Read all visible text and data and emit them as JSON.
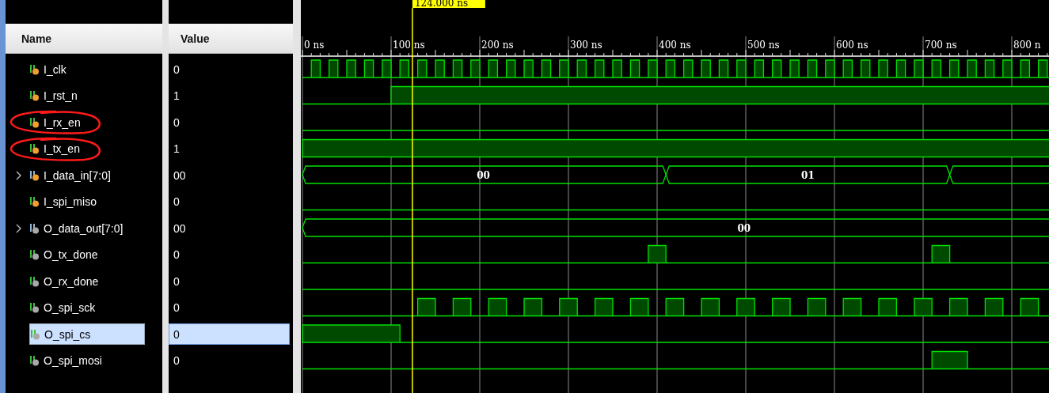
{
  "headers": {
    "name": "Name",
    "value": "Value"
  },
  "signals": [
    {
      "name": "I_clk",
      "value": "0",
      "kind": "bit",
      "input": true,
      "selected": false,
      "highlighted": false
    },
    {
      "name": "I_rst_n",
      "value": "1",
      "kind": "bit",
      "input": true,
      "selected": false,
      "highlighted": false
    },
    {
      "name": "I_rx_en",
      "value": "0",
      "kind": "bit",
      "input": true,
      "selected": false,
      "highlighted": true
    },
    {
      "name": "I_tx_en",
      "value": "1",
      "kind": "bit",
      "input": true,
      "selected": false,
      "highlighted": true
    },
    {
      "name": "I_data_in[7:0]",
      "value": "00",
      "kind": "bus",
      "input": true,
      "selected": false,
      "highlighted": false,
      "bus_values": [
        "00",
        "01"
      ]
    },
    {
      "name": "I_spi_miso",
      "value": "0",
      "kind": "bit",
      "input": true,
      "selected": false,
      "highlighted": false
    },
    {
      "name": "O_data_out[7:0]",
      "value": "00",
      "kind": "bus",
      "input": false,
      "selected": false,
      "highlighted": false,
      "bus_values": [
        "00"
      ]
    },
    {
      "name": "O_tx_done",
      "value": "0",
      "kind": "bit",
      "input": false,
      "selected": false,
      "highlighted": false
    },
    {
      "name": "O_rx_done",
      "value": "0",
      "kind": "bit",
      "input": false,
      "selected": false,
      "highlighted": false
    },
    {
      "name": "O_spi_sck",
      "value": "0",
      "kind": "bit",
      "input": false,
      "selected": false,
      "highlighted": false
    },
    {
      "name": "O_spi_cs",
      "value": "0",
      "kind": "bit",
      "input": false,
      "selected": true,
      "highlighted": false
    },
    {
      "name": "O_spi_mosi",
      "value": "0",
      "kind": "bit",
      "input": false,
      "selected": false,
      "highlighted": false
    }
  ],
  "waveform": {
    "cursor_label": "124.000 ns",
    "ruler_labels": [
      "0 ns",
      "100 ns",
      "200 ns",
      "300 ns",
      "400 ns",
      "500 ns",
      "600 ns",
      "700 ns",
      "800 n"
    ]
  }
}
